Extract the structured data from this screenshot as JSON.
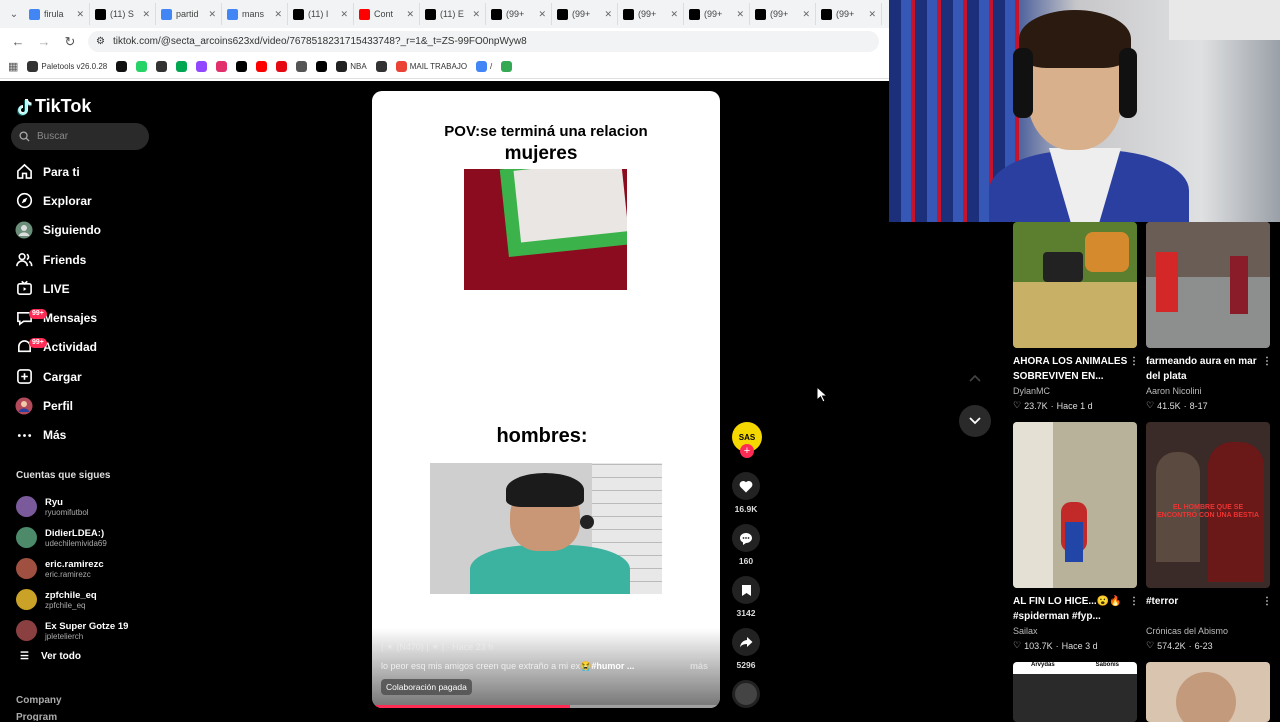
{
  "browser": {
    "tabs": [
      {
        "title": "firula",
        "icon": "google-icon",
        "color": "#4285f4"
      },
      {
        "title": "(11) S",
        "icon": "x-icon",
        "color": "#000000"
      },
      {
        "title": "partid",
        "icon": "google-icon",
        "color": "#4285f4"
      },
      {
        "title": "mans",
        "icon": "google-icon",
        "color": "#4285f4"
      },
      {
        "title": "(11) I",
        "icon": "x-icon",
        "color": "#000000"
      },
      {
        "title": "Cont",
        "icon": "youtube-icon",
        "color": "#ff0000"
      },
      {
        "title": "(11) E",
        "icon": "x-icon",
        "color": "#000000"
      },
      {
        "title": "(99+",
        "icon": "tiktok-icon",
        "color": "#000000"
      },
      {
        "title": "(99+",
        "icon": "tiktok-icon",
        "color": "#000000"
      },
      {
        "title": "(99+",
        "icon": "tiktok-icon",
        "color": "#000000"
      },
      {
        "title": "(99+",
        "icon": "tiktok-icon",
        "color": "#000000"
      },
      {
        "title": "(99+",
        "icon": "tiktok-icon",
        "color": "#000000"
      },
      {
        "title": "(99+",
        "icon": "tiktok-icon",
        "color": "#000000"
      }
    ],
    "url": "tiktok.com/@secta_arcoins623xd/video/7678518231715433748?_r=1&_t=ZS-99FO0npWyw8",
    "bookmarks": [
      {
        "label": "Paletools v26.0.28",
        "color": "#333333"
      },
      {
        "label": "",
        "color": "#111111"
      },
      {
        "label": "",
        "color": "#25d366"
      },
      {
        "label": "",
        "color": "#333333"
      },
      {
        "label": "",
        "color": "#00a650"
      },
      {
        "label": "",
        "color": "#9146ff"
      },
      {
        "label": "",
        "color": "#e1306c"
      },
      {
        "label": "",
        "color": "#000000"
      },
      {
        "label": "",
        "color": "#ff0000"
      },
      {
        "label": "",
        "color": "#e50914"
      },
      {
        "label": "",
        "color": "#555555"
      },
      {
        "label": "",
        "color": "#000000"
      },
      {
        "label": "NBA",
        "color": "#222222"
      },
      {
        "label": "",
        "color": "#333333"
      },
      {
        "label": "MAIL TRABAJO",
        "color": "#ea4335"
      },
      {
        "label": "/",
        "color": "#4285f4"
      },
      {
        "label": "",
        "color": "#34a853"
      }
    ]
  },
  "sidebar": {
    "logo": "TikTok",
    "search_placeholder": "Buscar",
    "nav": [
      {
        "label": "Para ti",
        "icon": "home-icon",
        "badge": ""
      },
      {
        "label": "Explorar",
        "icon": "compass-icon",
        "badge": ""
      },
      {
        "label": "Siguiendo",
        "icon": "following-avatar-icon",
        "badge": ""
      },
      {
        "label": "Friends",
        "icon": "friends-icon",
        "badge": ""
      },
      {
        "label": "LIVE",
        "icon": "live-icon",
        "badge": ""
      },
      {
        "label": "Mensajes",
        "icon": "messages-icon",
        "badge": "99+"
      },
      {
        "label": "Actividad",
        "icon": "activity-icon",
        "badge": "99+"
      },
      {
        "label": "Cargar",
        "icon": "upload-icon",
        "badge": ""
      },
      {
        "label": "Perfil",
        "icon": "profile-avatar-icon",
        "badge": ""
      },
      {
        "label": "Más",
        "icon": "more-icon",
        "badge": ""
      }
    ],
    "following_title": "Cuentas que sigues",
    "following": [
      {
        "name": "Ryu",
        "handle": "ryuomifutbol",
        "color": "#7a5a9a"
      },
      {
        "name": "DidierLDEA:)",
        "handle": "udechilemivida69",
        "color": "#4c8a6a"
      },
      {
        "name": "eric.ramirezc",
        "handle": "eric.ramirezc",
        "color": "#a05040"
      },
      {
        "name": "zpfchile_eq",
        "handle": "zpfchile_eq",
        "color": "#c9a227"
      },
      {
        "name": "Ex Super Gotze 19",
        "handle": "jpletelierch",
        "color": "#8a4040"
      }
    ],
    "see_all": "Ver todo",
    "company": "Company",
    "program": "Program"
  },
  "video": {
    "text_top": "POV:se terminá una relacion",
    "text_mujeres": "mujeres",
    "text_hombres": "hombres:",
    "author_faded": "| ☀ (N470) | ☀ | · Hace 23 h",
    "caption": "lo peor esq mis amigos creen que extraño a mi ex😭",
    "hashtag": "#humor ...",
    "more": "más",
    "paid_tag": "Colaboración pagada",
    "progress": 0.57
  },
  "actions": {
    "creator_initials": "SAS",
    "likes": "16.9K",
    "comments": "160",
    "saves": "3142",
    "shares": "5296"
  },
  "recommendations": [
    {
      "title": "AHORA LOS ANIMALES SOBREVIVEN EN...",
      "author": "DylanMC",
      "likes": "23.7K",
      "age": "Hace 1 d",
      "bg": "#5b7f2f"
    },
    {
      "title": "farmeando aura en mar del plata",
      "author": "Aaron Nicolini",
      "likes": "41.5K",
      "age": "8-17",
      "bg": "#8c8f8e"
    },
    {
      "title": "AL FIN LO HICE...😮🔥 #spiderman #fyp...",
      "author": "Sailax",
      "likes": "103.7K",
      "age": "Hace 3 d",
      "bg": "#b9b29a"
    },
    {
      "title": "#terror",
      "author": "Crónicas del Abismo",
      "likes": "574.2K",
      "age": "6-23",
      "bg": "#3a2a28"
    },
    {
      "title": "",
      "author": "",
      "likes": "",
      "age": "",
      "bg": "#2a2a2a"
    },
    {
      "title": "",
      "author": "",
      "likes": "",
      "age": "",
      "bg": "#d9c4b0"
    }
  ],
  "terror_thumb_text": "EL HOMBRE QUE SE ENCONTRÓ CON UNA BESTIA",
  "thumb5_labels": [
    "Arvydas",
    "Sabonis"
  ]
}
